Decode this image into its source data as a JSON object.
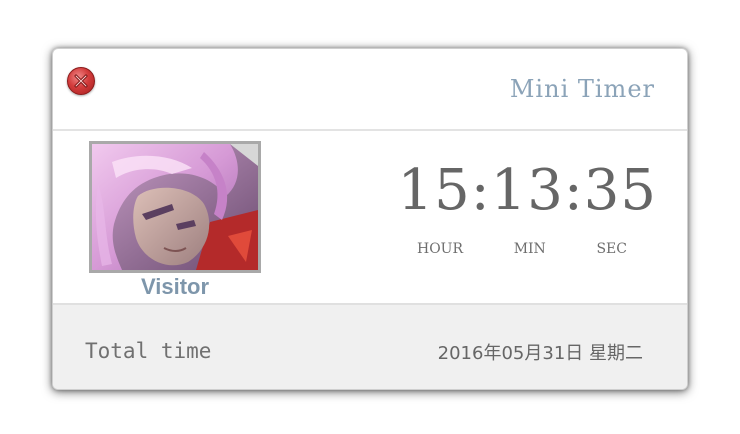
{
  "header": {
    "close_icon": "close-icon",
    "title": "Mini Timer"
  },
  "profile": {
    "username": "Visitor"
  },
  "clock": {
    "time": "15:13:35",
    "labels": [
      "HOUR",
      "MIN",
      "SEC"
    ]
  },
  "footer": {
    "total_time_label": "Total time",
    "date": "2016年05月31日 星期二"
  },
  "colors": {
    "title": "#8ba3b8",
    "username": "#7e96ab",
    "clock": "#666666",
    "close": "#d33c3c",
    "footer_bg": "#f0f0f0"
  }
}
